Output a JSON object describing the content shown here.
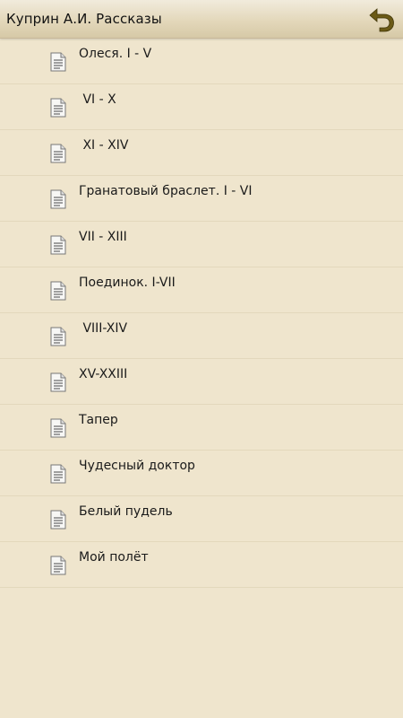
{
  "header": {
    "title": "Куприн А.И. Рассказы",
    "back_icon": "undo-arrow-icon",
    "accent_color": "#6b5a16"
  },
  "list": {
    "items": [
      {
        "label": "Олеся. I - V"
      },
      {
        "label": " VI - X"
      },
      {
        "label": " XI - XIV"
      },
      {
        "label": "Гранатовый браслет. I - VI"
      },
      {
        "label": "VII - XIII"
      },
      {
        "label": "Поединок. I-VII"
      },
      {
        "label": " VIII-XIV"
      },
      {
        "label": "XV-XXIII"
      },
      {
        "label": "Тапер"
      },
      {
        "label": "Чудесный доктор"
      },
      {
        "label": "Белый пудель"
      },
      {
        "label": "Мой полёт"
      }
    ],
    "item_icon": "document-icon"
  }
}
